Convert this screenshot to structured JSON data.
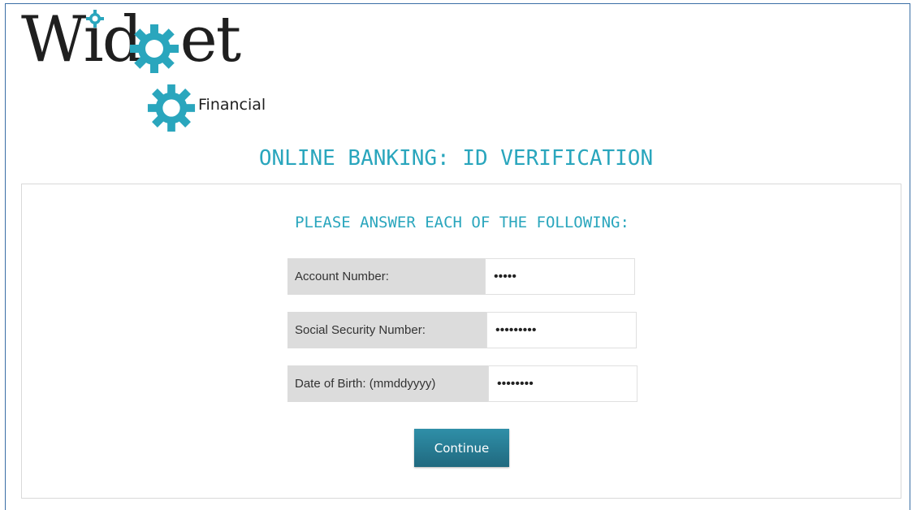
{
  "brand": {
    "logo_text": "Widget",
    "logo_subtext": "Financial",
    "accent_color": "#2aa6bd"
  },
  "page": {
    "title": "ONLINE BANKING: ID VERIFICATION"
  },
  "form": {
    "heading": "PLEASE ANSWER EACH OF THE FOLLOWING:",
    "fields": [
      {
        "label": "Account Number:",
        "value": "•••••"
      },
      {
        "label": "Social Security Number:",
        "value": "•••••••••"
      },
      {
        "label": "Date of Birth: (mmddyyyy)",
        "value": "••••••••"
      }
    ],
    "submit_label": "Continue"
  }
}
